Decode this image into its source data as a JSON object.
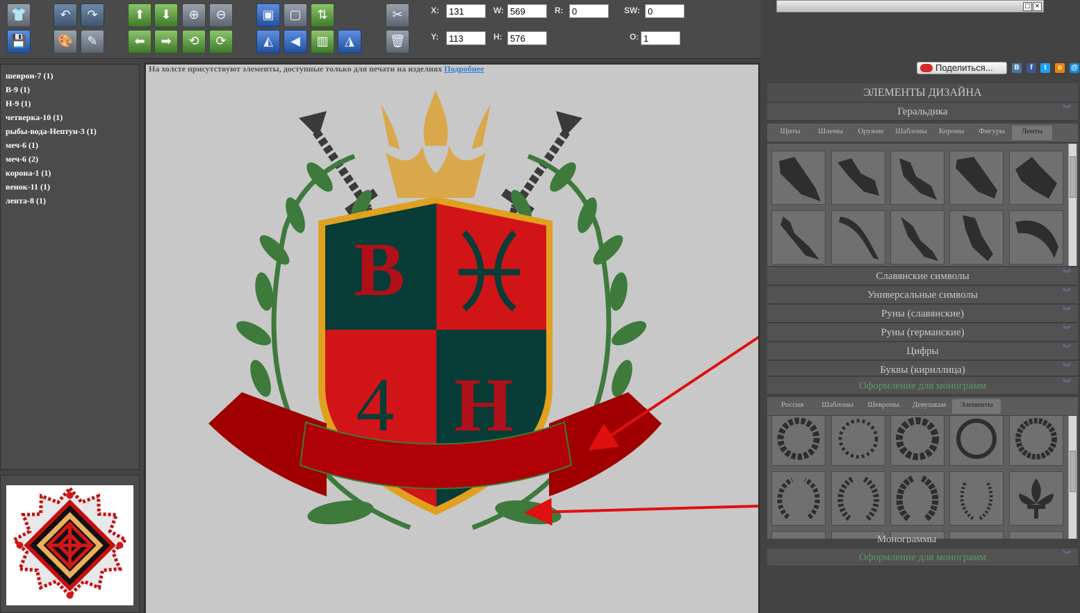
{
  "toolbar": {
    "fields": {
      "x": {
        "label": "X:",
        "value": "131"
      },
      "w": {
        "label": "W:",
        "value": "569"
      },
      "r": {
        "label": "R:",
        "value": "0"
      },
      "sw": {
        "label": "SW:",
        "value": "0"
      },
      "y": {
        "label": "Y:",
        "value": "113"
      },
      "h": {
        "label": "H:",
        "value": "576"
      },
      "o": {
        "label": "O:",
        "value": "1"
      }
    }
  },
  "layers": [
    "шеврон-7 (1)",
    "В-9 (1)",
    "Н-9 (1)",
    "четверка-10 (1)",
    "рыбы-вода-Нептун-3 (1)",
    "меч-6 (1)",
    "меч-6 (2)",
    "корона-1 (1)",
    "венок-11 (1)",
    "лента-8 (1)"
  ],
  "canvas": {
    "notice": "На холсте присутствуют элементы, доступные только для печати на изделиях",
    "notice_link": "Подробнее",
    "emblem": {
      "letter_b": "В",
      "letter_h": "Н",
      "digit": "4"
    }
  },
  "colors": {
    "shield_red": "#d01418",
    "shield_teal": "#073c37",
    "crown_gold": "#d9a84a",
    "ribbon_red": "#a00000",
    "wreath_green": "#3d7a3c",
    "arrow_red": "#e01010"
  },
  "right_panel": {
    "share_label": "Поделиться...",
    "social_icons": [
      "vk-icon",
      "facebook-icon",
      "twitter-icon",
      "odnoklassniki-icon",
      "mail-icon"
    ],
    "title": "ЭЛЕМЕНТЫ ДИЗАЙНА",
    "heraldry": {
      "header": "Геральдика",
      "tabs": [
        "Щиты",
        "Шлемы",
        "Оружие",
        "Шаблоны",
        "Короны",
        "Фигуры",
        "Ленты"
      ],
      "active_tab": "Ленты"
    },
    "categories": [
      "Славянские символы",
      "Универсальные символы",
      "Руны (славянские)",
      "Руны (германские)",
      "Цифры",
      "Буквы (кириллица)"
    ],
    "monogram_section": {
      "header": "Оформление для монограмм",
      "tabs": [
        "Россия",
        "Шаблоны",
        "Шевроны",
        "Девушкам",
        "Элементы"
      ],
      "active_tab": "Элементы"
    },
    "overlapped_label": "Монограммы",
    "bottom_header": "Оформление для монограмм"
  }
}
